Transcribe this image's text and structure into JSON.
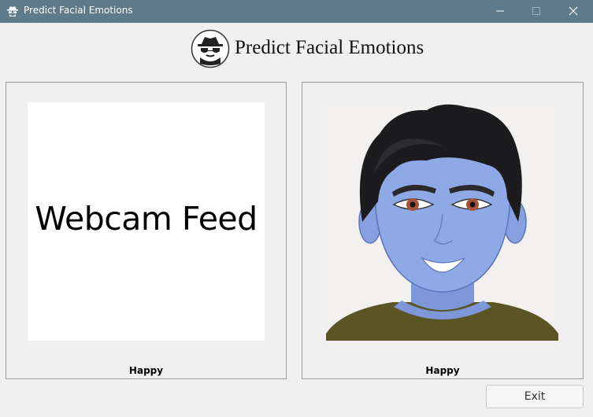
{
  "window": {
    "title": "Predict Facial Emotions",
    "icon": "spy-icon",
    "controls": [
      "minimize-icon",
      "maximize-icon",
      "close-icon"
    ]
  },
  "header": {
    "title": "Predict Facial Emotions",
    "logo": "spy-logo-icon"
  },
  "left_panel": {
    "feed_text": "Webcam Feed",
    "emotion_label": "Happy"
  },
  "right_panel": {
    "image": "happy-avatar",
    "emotion_label": "Happy"
  },
  "footer": {
    "exit_label": "Exit"
  },
  "colors": {
    "titlebar": "#5f7a8a",
    "background": "#f0f0f0",
    "avatar_skin": "#8fa8e6",
    "avatar_hair": "#1c1c1e",
    "avatar_shirt": "#5b5526"
  }
}
